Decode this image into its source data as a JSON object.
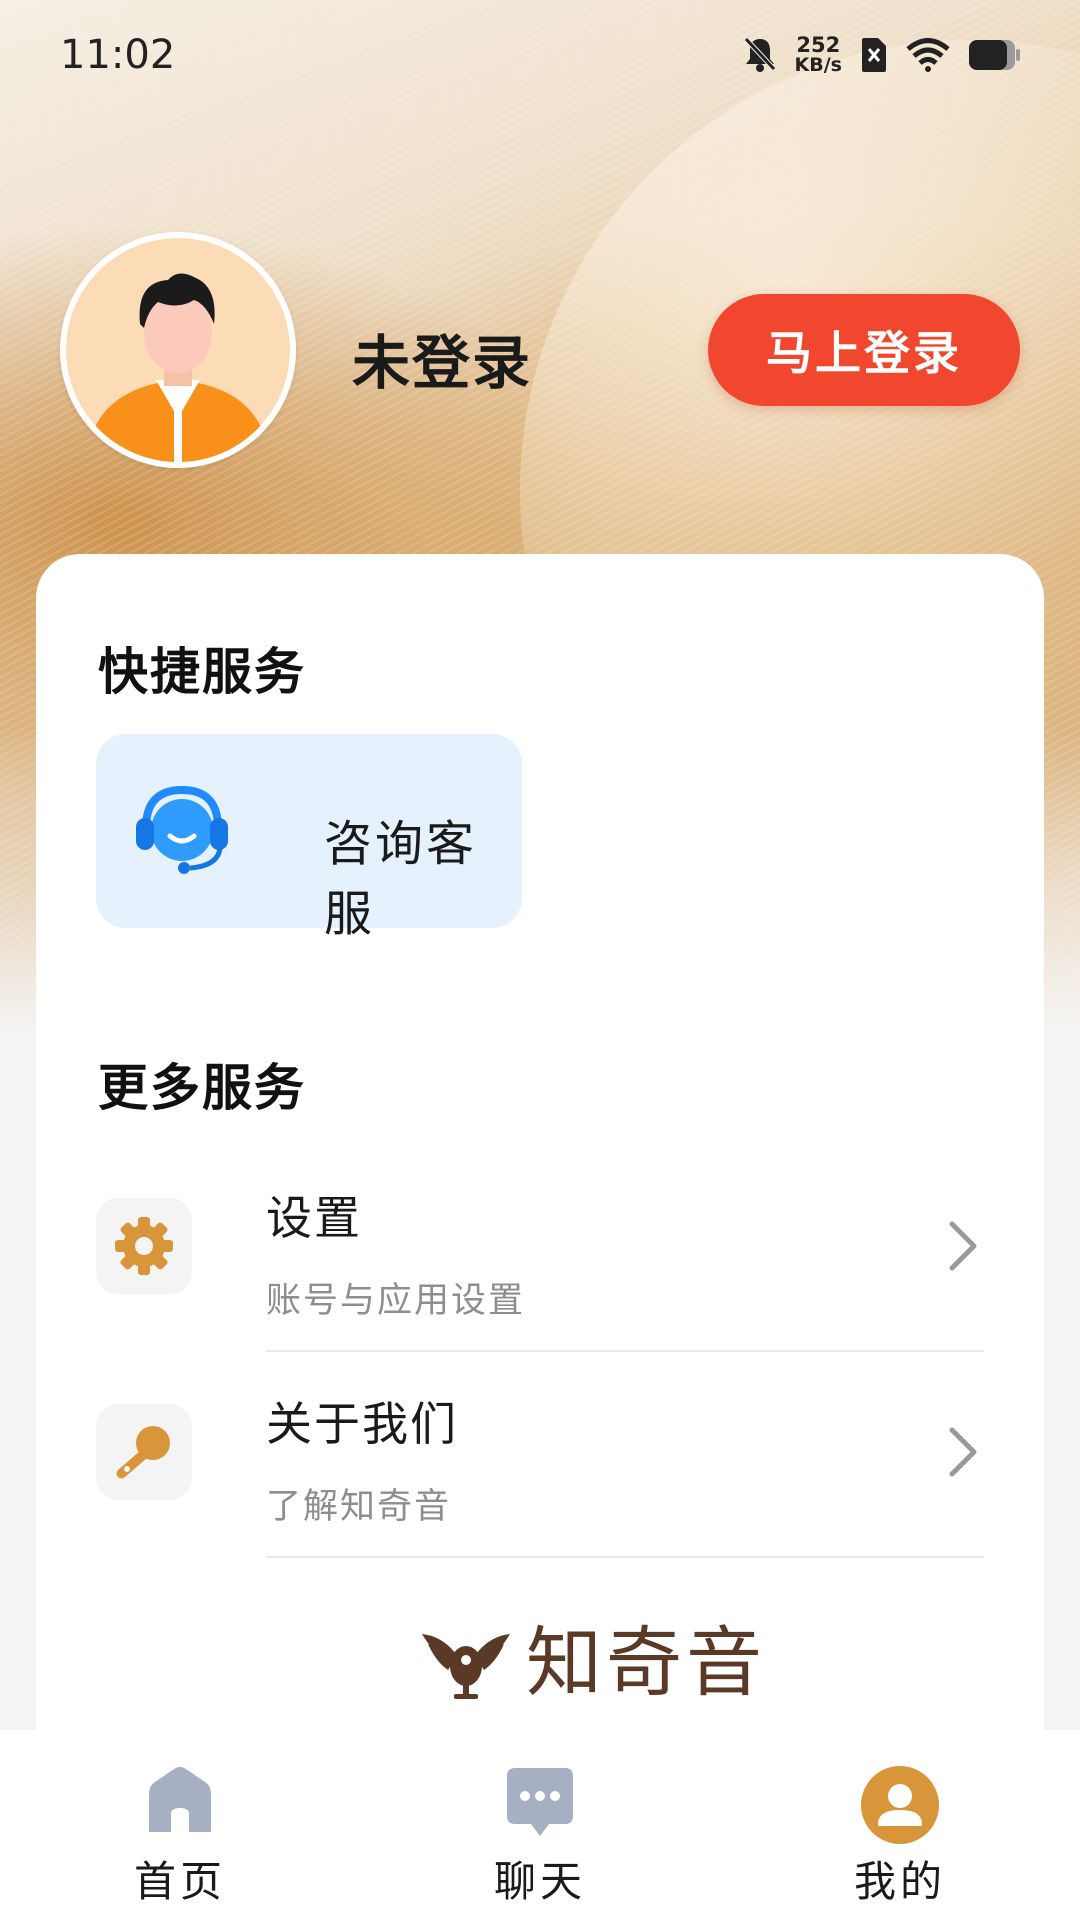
{
  "status_bar": {
    "time": "11:02",
    "net_speed_value": "252",
    "net_speed_unit": "KB/s",
    "icons": [
      "bell-off-icon",
      "sim-none-icon",
      "wifi-icon",
      "battery-icon"
    ]
  },
  "profile": {
    "name": "未登录",
    "login_button": "马上登录",
    "avatar": "default-avatar-icon"
  },
  "quick_services": {
    "title": "快捷服务",
    "items": [
      {
        "label": "咨询客服",
        "icon": "customer-service-headset-icon"
      }
    ]
  },
  "more_services": {
    "title": "更多服务",
    "items": [
      {
        "title": "设置",
        "subtitle": "账号与应用设置",
        "icon": "gear-icon"
      },
      {
        "title": "关于我们",
        "subtitle": "了解知奇音",
        "icon": "microphone-icon"
      }
    ]
  },
  "brand": {
    "name": "知奇音"
  },
  "bottom_nav": {
    "items": [
      {
        "label": "首页",
        "icon": "home-icon",
        "active": false
      },
      {
        "label": "聊天",
        "icon": "chat-bubble-icon",
        "active": false
      },
      {
        "label": "我的",
        "icon": "profile-icon",
        "active": true
      }
    ]
  },
  "colors": {
    "accent_red": "#f1472f",
    "accent_gold": "#d9953a",
    "consult_bg": "#e5f1fd",
    "nav_inactive": "#a7afc2"
  }
}
